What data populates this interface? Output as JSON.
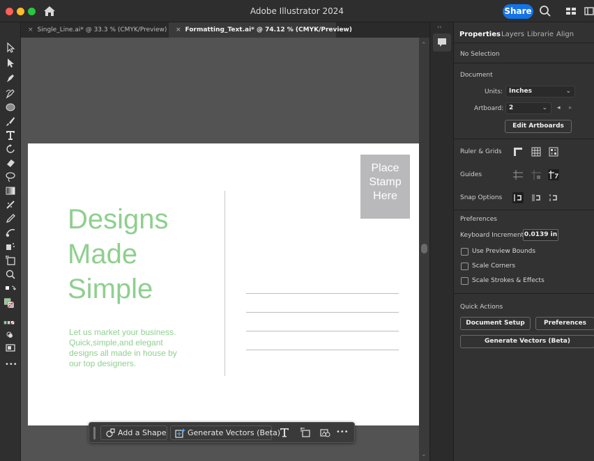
{
  "app": {
    "title": "Adobe Illustrator 2024",
    "share_label": "Share"
  },
  "tabs": [
    {
      "label": "Single_Line.ai* @ 33.3 % (CMYK/Preview)",
      "active": false
    },
    {
      "label": "Formatting_Text.ai* @ 74.12 % (CMYK/Preview)",
      "active": true
    }
  ],
  "artboard": {
    "headline": [
      "Designs",
      "Made",
      "Simple"
    ],
    "body_lines": [
      "Let us market your business.",
      "Quick,simple,and elegant",
      "designs all made in house by",
      "our top designers."
    ],
    "stamp_lines": [
      "Place",
      "Stamp",
      "Here"
    ],
    "accent_color": "#8fcf8f",
    "stamp_color": "#b9b9bb"
  },
  "contextual_taskbar": {
    "add_shape_label": "Add a Shape",
    "generate_vectors_label": "Generate Vectors (Beta)",
    "more_glyph": "•••"
  },
  "tools_more_glyph": "•••",
  "properties": {
    "tabs": [
      "Properties",
      "Layers",
      "Librarie",
      "Align"
    ],
    "selection": "No Selection",
    "document": {
      "section_title": "Document",
      "units_label": "Units:",
      "units_value": "Inches",
      "artboard_label": "Artboard:",
      "artboard_value": "2",
      "edit_artboards_label": "Edit Artboards"
    },
    "ruler_grids_label": "Ruler & Grids",
    "guides_label": "Guides",
    "snap_options_label": "Snap Options",
    "preferences": {
      "section_title": "Preferences",
      "keyboard_increment_label": "Keyboard Increment:",
      "keyboard_increment_value": "0.0139 in",
      "checkboxes": [
        "Use Preview Bounds",
        "Scale Corners",
        "Scale Strokes & Effects"
      ]
    },
    "quick_actions": {
      "section_title": "Quick Actions",
      "document_setup_label": "Document Setup",
      "preferences_label": "Preferences",
      "generate_vectors_label": "Generate Vectors (Beta)"
    }
  }
}
